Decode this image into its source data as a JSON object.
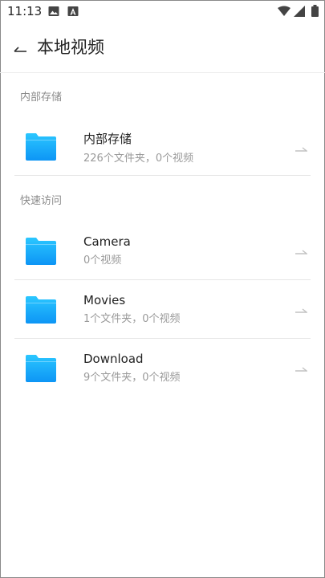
{
  "status_bar": {
    "time": "11:13",
    "icons": [
      "image-icon",
      "text-a-icon",
      "wifi-icon",
      "signal-icon",
      "battery-icon"
    ]
  },
  "header": {
    "back_icon": "back-arrow-icon",
    "title": "本地视频"
  },
  "internal_storage": {
    "section_label": "内部存储",
    "item": {
      "name": "内部存储",
      "subtitle": "226个文件夹，0个视频"
    }
  },
  "quick_access": {
    "section_label": "快速访问",
    "items": [
      {
        "name": "Camera",
        "subtitle": "0个视频"
      },
      {
        "name": "Movies",
        "subtitle": "1个文件夹，0个视频"
      },
      {
        "name": "Download",
        "subtitle": "9个文件夹，0个视频"
      }
    ]
  },
  "colors": {
    "folder_top": "#2bc7ff",
    "folder_bottom": "#0d95f5",
    "secondary_text": "#9a9a9a",
    "divider": "#e6e6e6"
  }
}
